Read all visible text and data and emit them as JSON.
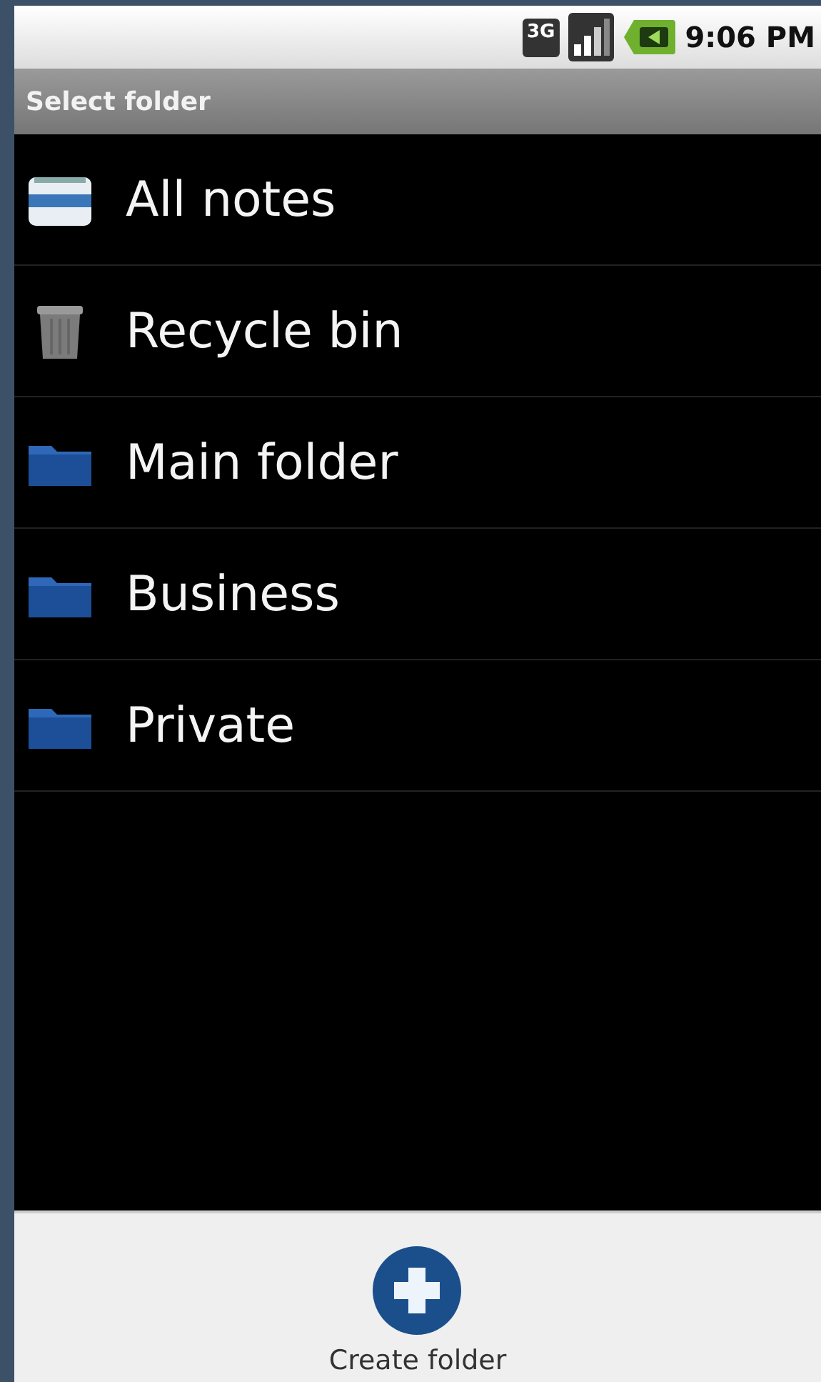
{
  "status_bar": {
    "network": "3G",
    "time": "9:06 PM"
  },
  "title": "Select folder",
  "folders": [
    {
      "kind": "notes",
      "label": "All notes"
    },
    {
      "kind": "trash",
      "label": "Recycle bin"
    },
    {
      "kind": "folder",
      "label": "Main folder"
    },
    {
      "kind": "folder",
      "label": "Business"
    },
    {
      "kind": "folder",
      "label": "Private"
    }
  ],
  "action": {
    "label": "Create folder"
  }
}
